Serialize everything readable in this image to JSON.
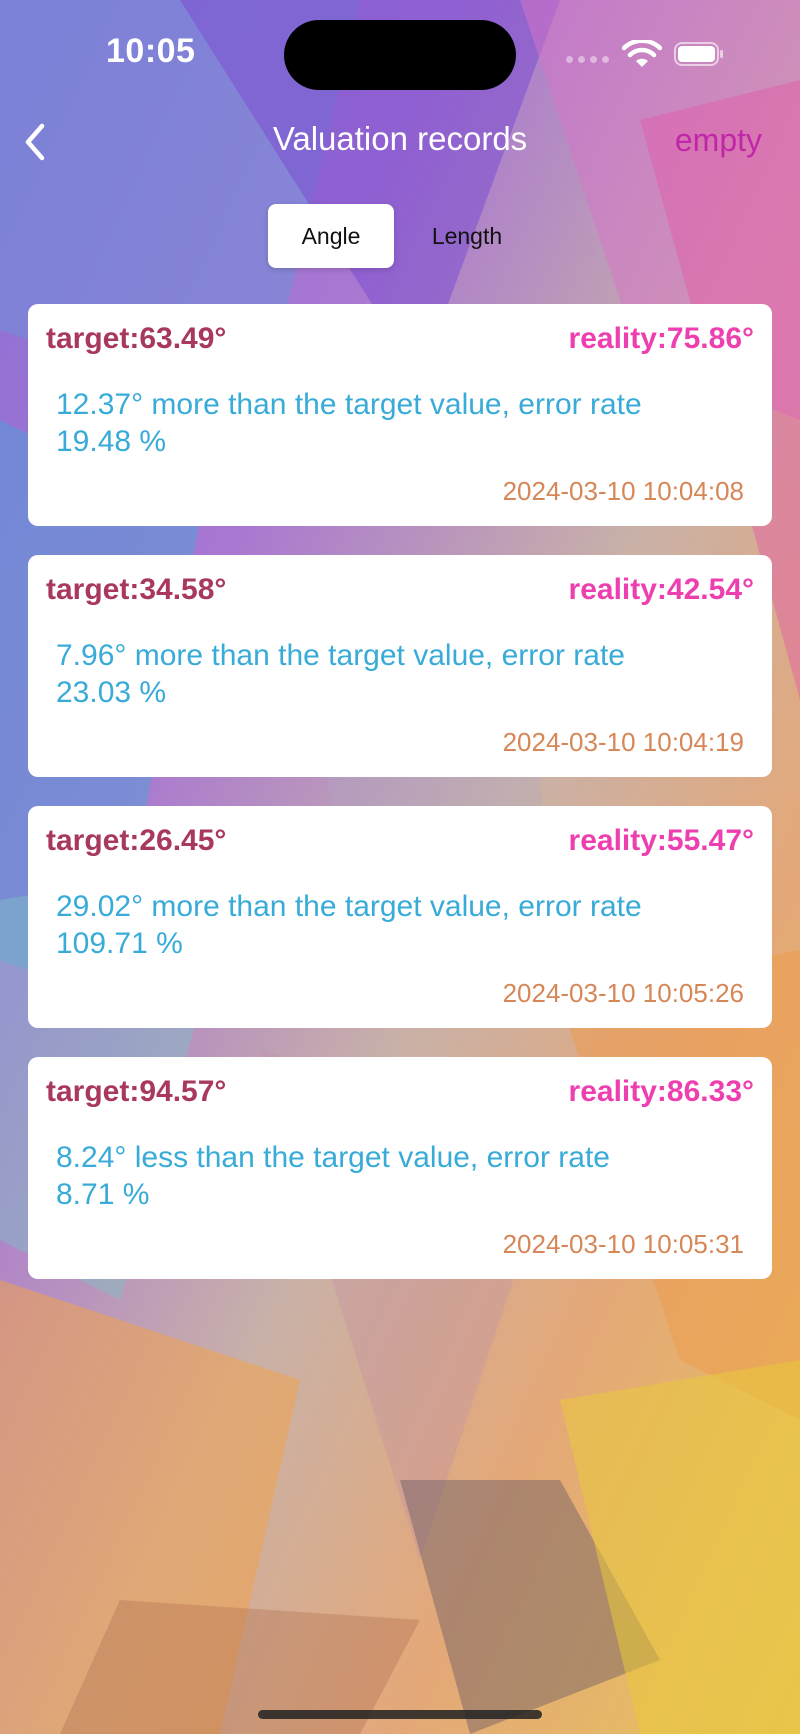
{
  "status_bar": {
    "time": "10:05"
  },
  "nav": {
    "title": "Valuation records",
    "action_label": "empty"
  },
  "segments": [
    {
      "label": "Angle",
      "selected": true
    },
    {
      "label": "Length",
      "selected": false
    }
  ],
  "records": [
    {
      "target": "target:63.49°",
      "reality": "reality:75.86°",
      "description": "12.37° more than the target value, error rate 19.48 %",
      "timestamp": "2024-03-10 10:04:08"
    },
    {
      "target": "target:34.58°",
      "reality": "reality:42.54°",
      "description": "7.96° more than the target value, error rate 23.03 %",
      "timestamp": "2024-03-10 10:04:19"
    },
    {
      "target": "target:26.45°",
      "reality": "reality:55.47°",
      "description": "29.02° more than the target value, error rate 109.71 %",
      "timestamp": "2024-03-10 10:05:26"
    },
    {
      "target": "target:94.57°",
      "reality": "reality:86.33°",
      "description": "8.24° less than the target value, error rate 8.71 %",
      "timestamp": "2024-03-10 10:05:31"
    }
  ],
  "colors": {
    "target_text": "#a8385f",
    "reality_text": "#ee3fb0",
    "description_text": "#38abd8",
    "timestamp_text": "#d68757",
    "action_text": "#c026a8"
  },
  "icons": {
    "back": "chevron-left-icon",
    "wifi": "wifi-icon",
    "battery": "battery-icon",
    "signal": "cellular-signal-icon"
  }
}
